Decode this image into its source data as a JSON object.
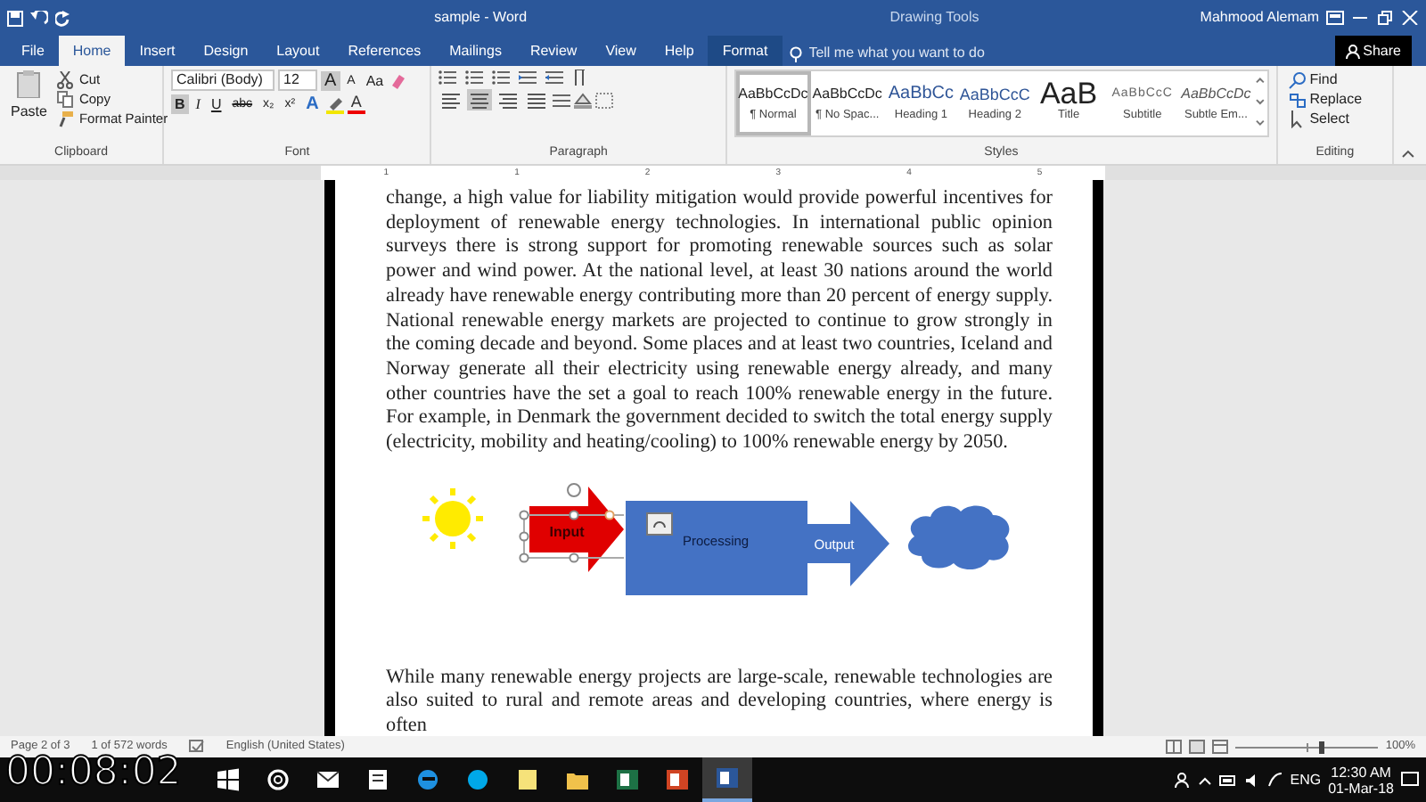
{
  "window": {
    "title": "sample - Word",
    "contextual_title": "Drawing Tools",
    "user": "Mahmood Alemam"
  },
  "tabs": [
    {
      "label": "File",
      "selected": false,
      "kind": "file"
    },
    {
      "label": "Home",
      "selected": true,
      "kind": "normal"
    },
    {
      "label": "Insert",
      "selected": false,
      "kind": "normal"
    },
    {
      "label": "Design",
      "selected": false,
      "kind": "normal"
    },
    {
      "label": "Layout",
      "selected": false,
      "kind": "normal"
    },
    {
      "label": "References",
      "selected": false,
      "kind": "normal"
    },
    {
      "label": "Mailings",
      "selected": false,
      "kind": "normal"
    },
    {
      "label": "Review",
      "selected": false,
      "kind": "normal"
    },
    {
      "label": "View",
      "selected": false,
      "kind": "normal"
    },
    {
      "label": "Help",
      "selected": false,
      "kind": "normal"
    },
    {
      "label": "Format",
      "selected": false,
      "kind": "contextual"
    }
  ],
  "tell_me": {
    "placeholder": "Tell me what you want to do"
  },
  "share": "Share",
  "clipboard": {
    "paste": "Paste",
    "items": [
      {
        "label": "Cut",
        "kind": "cut"
      },
      {
        "label": "Copy",
        "kind": "copy"
      },
      {
        "label": "Format Painter",
        "kind": "painter"
      }
    ],
    "label": "Clipboard"
  },
  "font": {
    "name": "Calibri (Body)",
    "size": "12",
    "row1": [
      {
        "label": "A",
        "kind": "grow",
        "selected": true
      },
      {
        "label": "A",
        "kind": "shrink",
        "selected": false
      },
      {
        "label": "Aa",
        "kind": "case",
        "selected": false
      }
    ],
    "row2": [
      {
        "label": "B",
        "kind": "bold",
        "selected": true
      },
      {
        "label": "I",
        "kind": "italic",
        "selected": false
      },
      {
        "label": "U",
        "kind": "underline",
        "selected": false
      },
      {
        "label": "abc",
        "kind": "strike",
        "selected": false
      },
      {
        "label": "x₂",
        "kind": "sub",
        "selected": false
      },
      {
        "label": "x²",
        "kind": "sup",
        "selected": false
      },
      {
        "label": "A",
        "kind": "effects",
        "selected": false
      },
      {
        "label": "A",
        "kind": "color",
        "selected": false
      }
    ],
    "label": "Font"
  },
  "paragraph": {
    "align": [
      {
        "selected": false
      },
      {
        "selected": true
      },
      {
        "selected": false
      },
      {
        "selected": false
      }
    ],
    "label": "Paragraph"
  },
  "styles": {
    "items": [
      {
        "preview": "AaBbCcDc",
        "name": "¶ Normal",
        "kind": "normal",
        "selected": true
      },
      {
        "preview": "AaBbCcDc",
        "name": "¶ No Spac...",
        "kind": "normal",
        "selected": false
      },
      {
        "preview": "AaBbCc",
        "name": "Heading 1",
        "kind": "heading1",
        "selected": false
      },
      {
        "preview": "AaBbCcC",
        "name": "Heading 2",
        "kind": "heading2",
        "selected": false
      },
      {
        "preview": "AaB",
        "name": "Title",
        "kind": "title",
        "selected": false
      },
      {
        "preview": "AaBbCcC",
        "name": "Subtitle",
        "kind": "subtitle",
        "selected": false
      },
      {
        "preview": "AaBbCcDc",
        "name": "Subtle Em...",
        "kind": "emphasis",
        "selected": false
      }
    ],
    "label": "Styles"
  },
  "editing": {
    "items": [
      {
        "label": "Find",
        "kind": "find"
      },
      {
        "label": "Replace",
        "kind": "replace"
      },
      {
        "label": "Select",
        "kind": "select"
      }
    ],
    "label": "Editing"
  },
  "ruler": [
    "1",
    "1",
    "2",
    "3",
    "4",
    "5"
  ],
  "document": {
    "paragraphs": [
      {
        "text": "change, a high value for liability mitigation would provide powerful incentives for deployment of renewable energy technologies. In international public opinion surveys there is strong support for promoting renewable sources such as solar power and wind power. At the national level, at least 30 nations around the world already have renewable energy contributing more than 20 percent of energy supply. National renewable energy markets are projected to continue to grow strongly in the coming decade and beyond. Some places and at least two countries, Iceland and Norway generate all their electricity using renewable energy already, and many other countries have the set a goal to reach 100% renewable energy in the future. For example, in Denmark the government decided to switch the total energy supply (electricity, mobility and heating/cooling) to 100% renewable energy by 2050."
      }
    ],
    "diagram": {
      "input": "Input",
      "processing": "Processing",
      "output": "Output"
    },
    "paragraphs_after": [
      {
        "text": "While many renewable energy projects are large-scale, renewable technologies are also suited to rural and remote areas and developing countries, where energy is often"
      }
    ]
  },
  "status_bar": {
    "page": "Page 2 of 3",
    "words": "1 of 572 words",
    "language": "English (United States)",
    "zoom_slider": {
      "level": 0.6
    },
    "zoom": "100%"
  },
  "taskbar": {
    "apps": [
      {
        "kind": "start",
        "selected": false
      },
      {
        "kind": "cortana",
        "selected": false
      },
      {
        "kind": "mail",
        "selected": false
      },
      {
        "kind": "note",
        "selected": false
      },
      {
        "kind": "edge",
        "selected": false
      },
      {
        "kind": "skype",
        "selected": false
      },
      {
        "kind": "sticky",
        "selected": false
      },
      {
        "kind": "folder",
        "selected": false
      },
      {
        "kind": "excel",
        "selected": false
      },
      {
        "kind": "powerpoint",
        "selected": false
      },
      {
        "kind": "word",
        "selected": true
      }
    ],
    "language": "ENG",
    "time": "12:30 AM",
    "date": "01-Mar-18"
  },
  "timer": "00:08:02"
}
